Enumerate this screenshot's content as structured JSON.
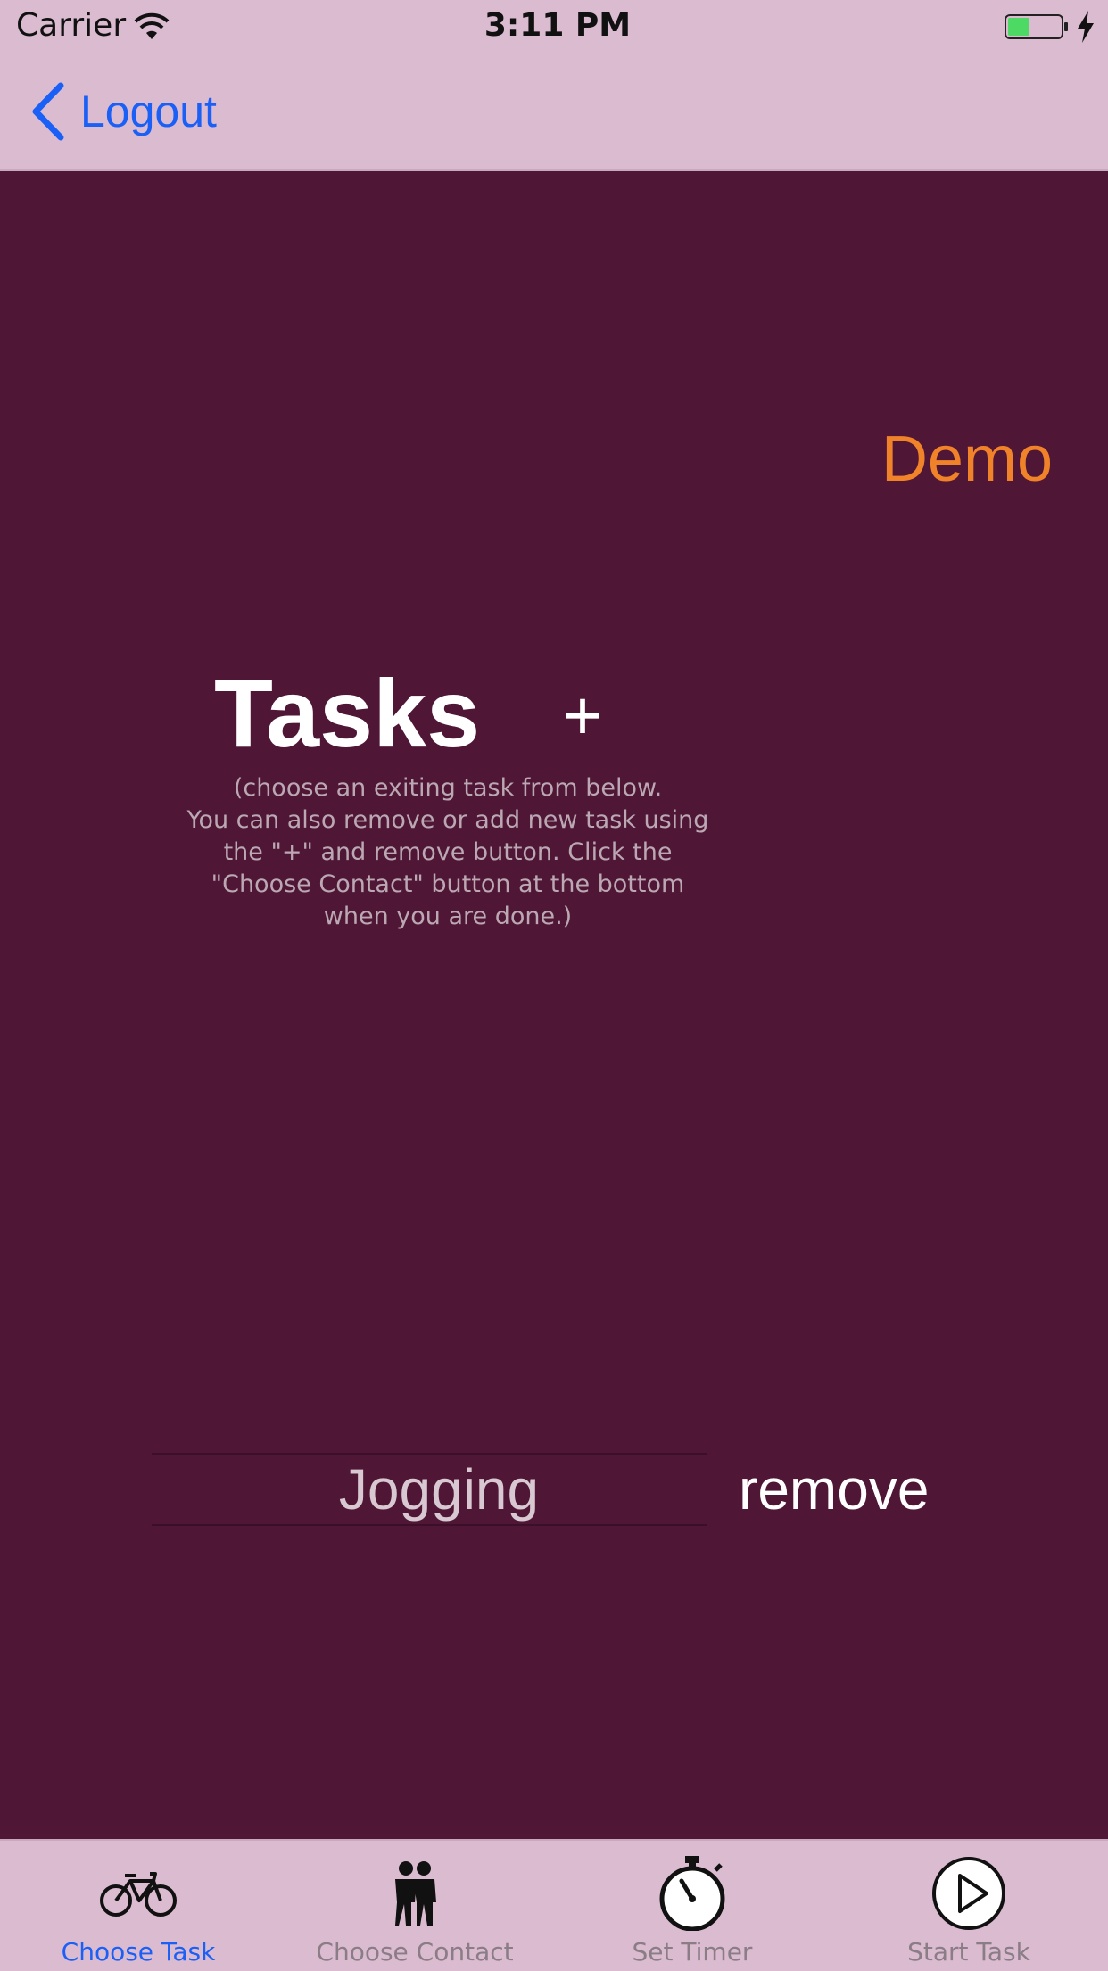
{
  "status_bar": {
    "carrier": "Carrier",
    "time": "3:11 PM",
    "wifi_icon": "wifi-icon",
    "battery_icon": "battery-charging-icon"
  },
  "nav": {
    "back_label": "Logout",
    "back_icon": "chevron-left-icon"
  },
  "main": {
    "demo_label": "Demo",
    "title": "Tasks",
    "add_label": "+",
    "instructions": "(choose an exiting task from below.\nYou can also remove or add new task using\nthe \"+\" and remove button. Click the\n\"Choose Contact\" button at the bottom\nwhen you are done.)",
    "picker": {
      "items": [
        "Jogging"
      ],
      "selected": "Jogging"
    },
    "remove_label": "remove"
  },
  "tabs": [
    {
      "label": "Choose Task",
      "icon": "bicycle-icon",
      "active": true
    },
    {
      "label": "Choose Contact",
      "icon": "people-icon",
      "active": false
    },
    {
      "label": "Set Timer",
      "icon": "stopwatch-icon",
      "active": false
    },
    {
      "label": "Start Task",
      "icon": "play-circle-icon",
      "active": false
    }
  ],
  "colors": {
    "background": "#4f1636",
    "bars": "#dbbbd0",
    "accent_blue": "#1a5ff6",
    "demo_orange": "#f0822a"
  }
}
